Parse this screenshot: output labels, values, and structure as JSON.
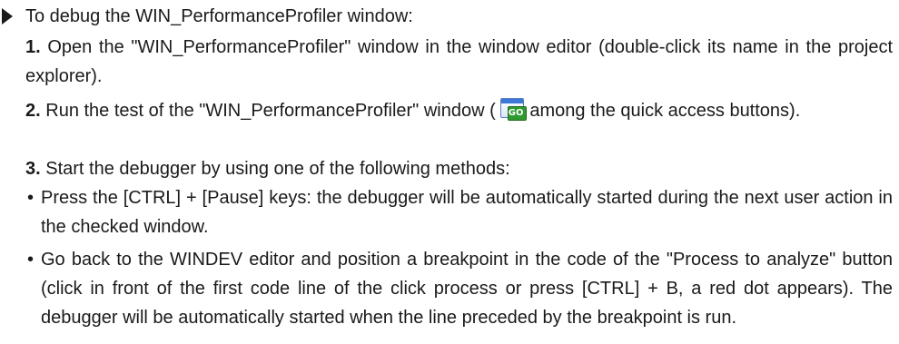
{
  "intro": "To debug the WIN_PerformanceProfiler window:",
  "steps": [
    {
      "number": "1.",
      "text": "Open the \"WIN_PerformanceProfiler\" window in the window editor (double-click its name in the project explorer)."
    },
    {
      "number": "2.",
      "text_before": "Run the test of the \"WIN_PerformanceProfiler\" window (",
      "icon": "go-test-window-icon",
      "icon_label": "GO",
      "text_after": " among the quick access buttons)."
    },
    {
      "number": "3.",
      "text": "Start the debugger by using one of the following methods:"
    }
  ],
  "bullets": [
    {
      "text": "Press the [CTRL] + [Pause] keys: the debugger will be automatically started during the next user action in the checked window."
    },
    {
      "text": "Go back to the WINDEV editor and position a breakpoint in the code of the \"Process to analyze\" button (click in front of the first code line of the click process or press [CTRL] + B, a red dot appears). The debugger will be automatically started when the line preceded by the breakpoint is run."
    }
  ],
  "bullet_symbol": "•",
  "colors": {
    "text": "#1a1a1a",
    "go_green": "#2f9a2f",
    "window_blue": "#3c78d8"
  }
}
